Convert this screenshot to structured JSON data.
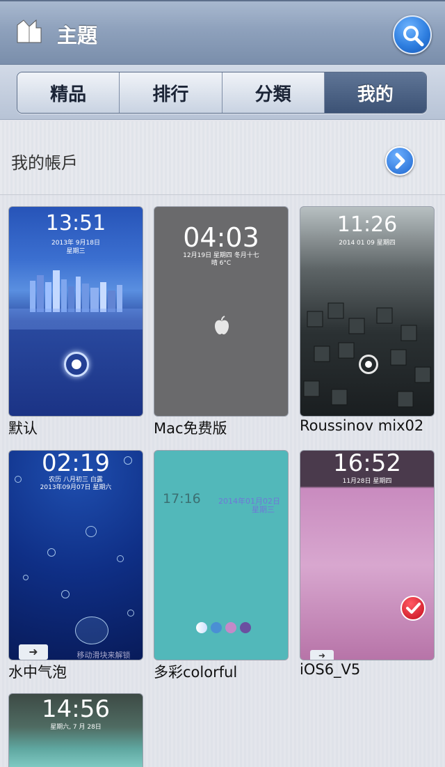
{
  "header": {
    "title": "主題",
    "logo_icon": "book-icon",
    "search_icon": "search-icon"
  },
  "tabs": [
    {
      "label": "精品",
      "active": false
    },
    {
      "label": "排行",
      "active": false
    },
    {
      "label": "分類",
      "active": false
    },
    {
      "label": "我的",
      "active": true
    }
  ],
  "account": {
    "label": "我的帳戶",
    "arrow_icon": "chevron-right-icon"
  },
  "themes": [
    {
      "name": "默认",
      "time": "13:51",
      "date": "2013年 9月18日",
      "weekday": "星期三"
    },
    {
      "name": "Mac免费版",
      "time": "04:03",
      "date": "12月19日 星期四 冬月十七",
      "weather": "晴  6°C"
    },
    {
      "name": "Roussinov mix02",
      "time": "11:26",
      "date": "2014 01 09  星期四"
    },
    {
      "name": "水中气泡",
      "time": "02:19",
      "date": "农历 八月初三 白露",
      "weekday": "2013年09月07日 星期六",
      "slider": "移动滑块来解锁"
    },
    {
      "name": "多彩colorful",
      "time": "17:16",
      "date": "2014年01月02日",
      "weekday": "星期三"
    },
    {
      "name": "iOS6_V5",
      "time": "16:52",
      "date": "11月28日 星期四",
      "selected": true
    },
    {
      "name": "",
      "time": "14:56",
      "date": "星期六, 7 月 28日"
    }
  ],
  "colors": {
    "header": "#8ea1bc",
    "active_tab": "#3c5275",
    "accent_blue": "#2f7fe0",
    "check_red": "#c40d1c"
  }
}
